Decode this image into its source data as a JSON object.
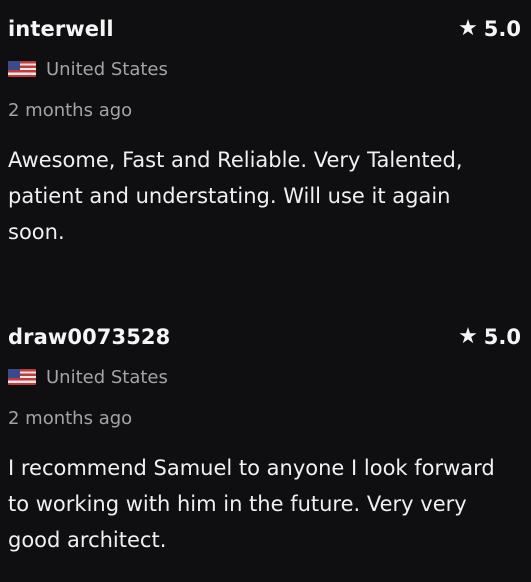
{
  "reviews": [
    {
      "username": "interwell",
      "rating": "5.0",
      "country": "United States",
      "time_ago": "2 months ago",
      "text": "Awesome, Fast and Reliable. Very Talented, patient and understating. Will use it again soon."
    },
    {
      "username": "draw0073528",
      "rating": "5.0",
      "country": "United States",
      "time_ago": "2 months ago",
      "text": "I recommend Samuel to anyone I look forward to working with him in the future. Very very good architect."
    }
  ],
  "icons": {
    "star": "star-icon",
    "flag": "us-flag-icon"
  },
  "colors": {
    "background": "#0f0f12",
    "primary_text": "#f2f2f2",
    "secondary_text": "#a3a3a8"
  }
}
